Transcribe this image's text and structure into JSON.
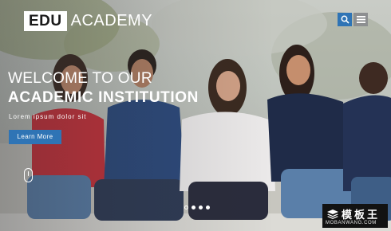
{
  "header": {
    "logo_box": "EDU",
    "logo_text": "ACADEMY",
    "search_icon": "search-icon",
    "menu_icon": "hamburger-menu-icon"
  },
  "hero": {
    "title_line1": "WELCOME TO OUR",
    "title_line2": "ACADEMIC INSTITUTION",
    "tagline": "Lorem ipsum dolor sit",
    "cta_label": "Learn More"
  },
  "slider": {
    "dots": [
      {
        "state": "inactive"
      },
      {
        "state": "active"
      },
      {
        "state": "active"
      },
      {
        "state": "active"
      }
    ]
  },
  "watermark": {
    "chinese": "模板王",
    "domain": "MOBANWANG.COM"
  },
  "colors": {
    "accent": "#2f74b5",
    "menu_button": "#8d8f91",
    "text": "#ffffff"
  }
}
